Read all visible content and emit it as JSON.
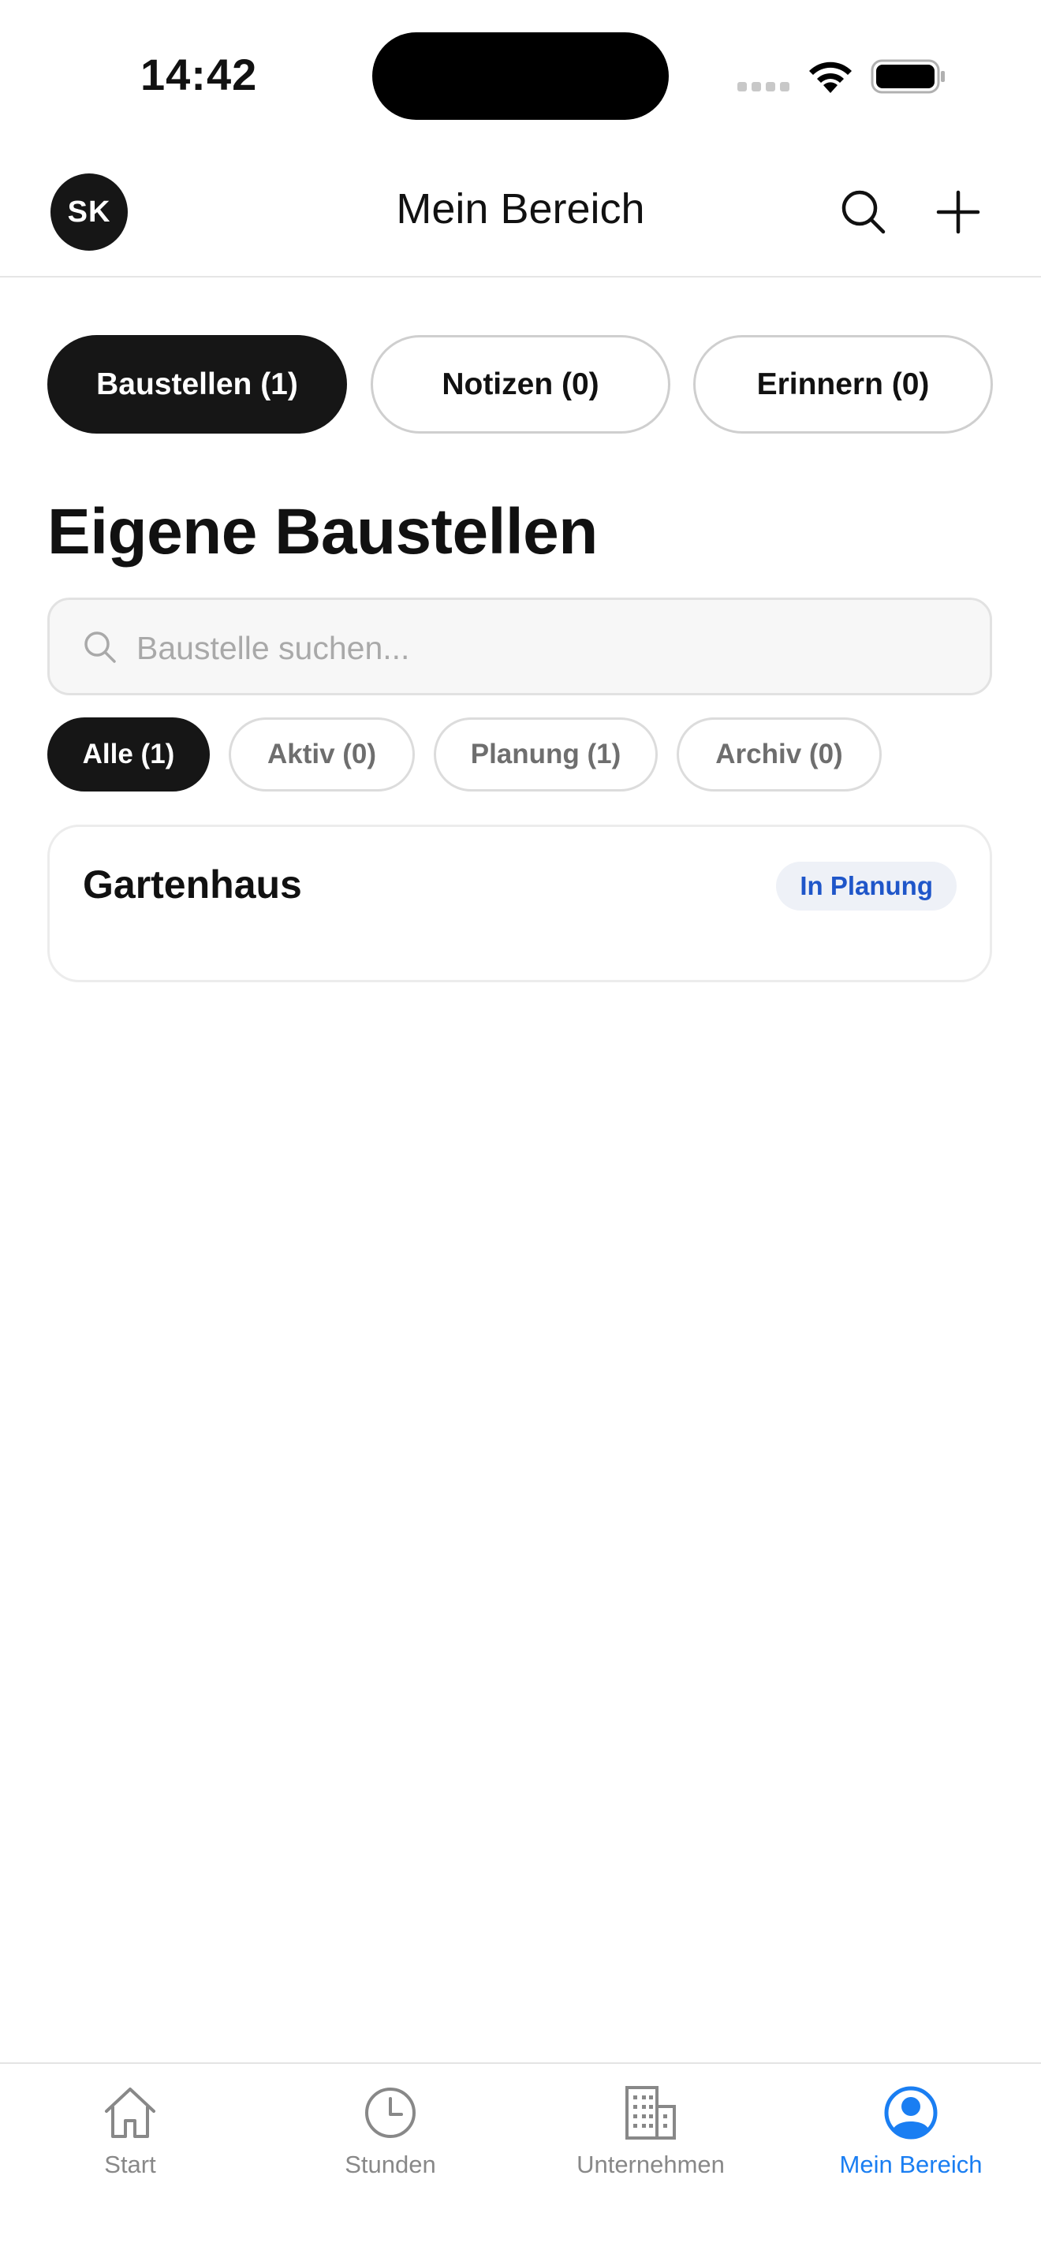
{
  "status_bar": {
    "time": "14:42"
  },
  "header": {
    "avatar_initials": "SK",
    "title": "Mein Bereich",
    "search_icon": "search-icon",
    "add_icon": "plus-icon"
  },
  "segments": [
    {
      "label": "Baustellen (1)",
      "active": true
    },
    {
      "label": "Notizen (0)",
      "active": false
    },
    {
      "label": "Erinnern (0)",
      "active": false
    }
  ],
  "section": {
    "title": "Eigene Baustellen"
  },
  "search": {
    "placeholder": "Baustelle suchen..."
  },
  "filters": [
    {
      "label": "Alle (1)",
      "active": true
    },
    {
      "label": "Aktiv (0)",
      "active": false
    },
    {
      "label": "Planung (1)",
      "active": false
    },
    {
      "label": "Archiv (0)",
      "active": false
    }
  ],
  "projects": [
    {
      "name": "Gartenhaus",
      "status": "In Planung"
    }
  ],
  "tabbar": {
    "items": [
      {
        "label": "Start",
        "icon": "home-icon",
        "active": false
      },
      {
        "label": "Stunden",
        "icon": "clock-icon",
        "active": false
      },
      {
        "label": "Unternehmen",
        "icon": "building-icon",
        "active": false
      },
      {
        "label": "Mein Bereich",
        "icon": "person-circle-icon",
        "active": true
      }
    ]
  },
  "colors": {
    "accent": "#1a7ef2",
    "dark": "#161616",
    "badge_text": "#1f56c9",
    "badge_bg": "#eef1f7"
  }
}
